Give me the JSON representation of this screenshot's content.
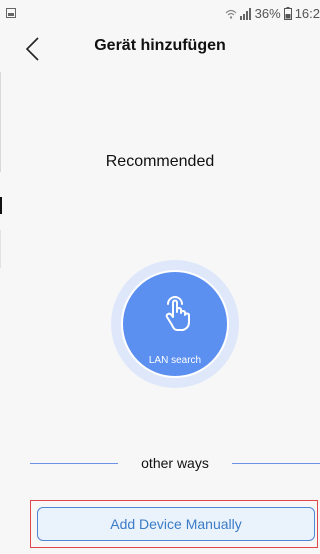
{
  "statusbar": {
    "battery_percent": "36%",
    "time": "16:2"
  },
  "header": {
    "title": "Gerät hinzufügen"
  },
  "main": {
    "recommended": "Recommended"
  },
  "lan_search": {
    "label": "LAN search",
    "icon": "tap-hand-icon"
  },
  "divider": {
    "text": "other ways"
  },
  "actions": {
    "add_device": "Add Device Manually"
  },
  "colors": {
    "accent": "#5b8ff0",
    "button_text": "#3b7bc7",
    "highlight": "#e04848"
  }
}
